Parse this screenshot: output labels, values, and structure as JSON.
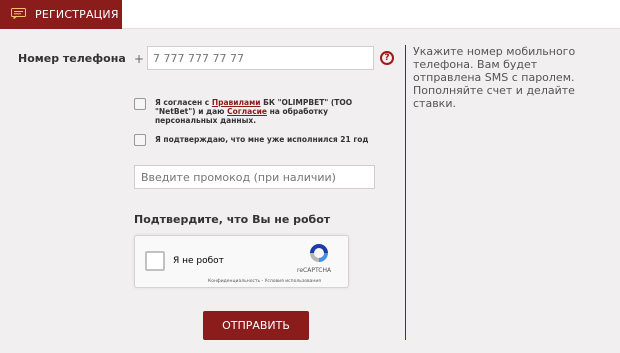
{
  "header": {
    "tab_label": "РЕГИСТРАЦИЯ",
    "tab_icon": "chat-bubble-icon"
  },
  "form": {
    "phone_label": "Номер телефона",
    "phone_prefix": "+",
    "phone_value": "7 777 777 77 77",
    "help_symbol": "?",
    "info_text": "Укажите номер мобильного телефона. Вам будет отправлена SMS с паролем. Пополняйте счет и делайте ставки.",
    "agree": {
      "prefix": "Я согласен с ",
      "rules_link": "Правилами",
      "middle": " БК \"OLIMPBET\" (ТОО \"NetBet\") и даю ",
      "consent_link": "Согласие",
      "suffix": " на обработку персональных данных."
    },
    "age_text": "Я подтверждаю, что мне уже исполнился 21 год",
    "promo_placeholder": "Введите промокод (при наличии)",
    "robot_title": "Подтвердите, что Вы не робот",
    "captcha": {
      "label": "Я не робот",
      "brand": "reCAPTCHA",
      "links": "Конфиденциальность - Условия использования"
    },
    "submit_label": "ОТПРАВИТЬ"
  },
  "colors": {
    "brand": "#8b1c1c",
    "panel_bg": "#f1efef"
  }
}
